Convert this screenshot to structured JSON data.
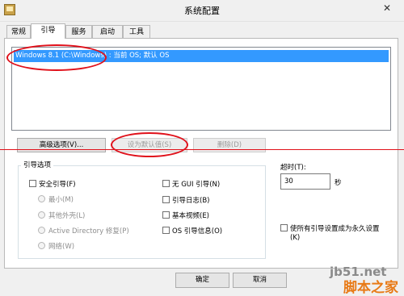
{
  "window": {
    "title": "系统配置",
    "close_glyph": "✕"
  },
  "tabs": [
    {
      "label": "常规",
      "active": false
    },
    {
      "label": "引导",
      "active": true
    },
    {
      "label": "服务",
      "active": false
    },
    {
      "label": "启动",
      "active": false
    },
    {
      "label": "工具",
      "active": false
    }
  ],
  "boot_list": {
    "selected_entry": "Windows 8.1 (C:\\Windows) : 当前 OS; 默认 OS"
  },
  "buttons": {
    "advanced": "高级选项(V)...",
    "set_default": "设为默认值(S)",
    "delete": "删除(D)",
    "ok": "确定",
    "cancel": "取消"
  },
  "boot_options": {
    "group_label": "引导选项",
    "safe_boot": "安全引导(F)",
    "minimal": "最小(M)",
    "alternate_shell": "其他外壳(L)",
    "active_directory": "Active Directory 修复(P)",
    "network": "网络(W)",
    "no_gui": "无 GUI 引导(N)",
    "boot_log": "引导日志(B)",
    "base_video": "基本视频(E)",
    "os_boot_info": "OS 引导信息(O)"
  },
  "timeout": {
    "label": "超时(T):",
    "value": "30",
    "unit": "秒"
  },
  "make_permanent": {
    "label_line1": "使所有引导设置成为永久设置",
    "label_line2": "(K)"
  },
  "watermark": {
    "line1": "jb51.net",
    "line2": "脚本之家"
  },
  "colors": {
    "selection": "#3399ff",
    "annotation_red": "#e0101a"
  }
}
